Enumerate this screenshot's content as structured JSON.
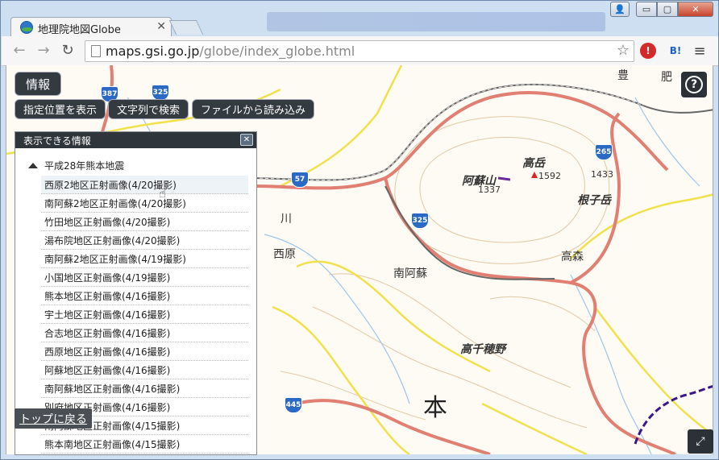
{
  "browser": {
    "tab_title": "地理院地図Globe",
    "tab_close": "✕",
    "url_host": "maps.gsi.go.jp",
    "url_path": "/globe/index_globe.html",
    "window_buttons": {
      "user": "👤",
      "minimize": "▭",
      "maximize": "▢",
      "close": "✕"
    },
    "ext_1": "!",
    "ext_2": "B!",
    "menu": "≡"
  },
  "toolbar": {
    "info_label": "情報",
    "show_location": "指定位置を表示",
    "search_text": "文字列で検索",
    "load_file": "ファイルから読み込み",
    "help": "?"
  },
  "panel": {
    "title": "表示できる情報",
    "close": "✕",
    "group": "平成28年熊本地震",
    "items": [
      "西原2地区正射画像(4/20撮影)",
      "南阿蘇2地区正射画像(4/20撮影)",
      "竹田地区正射画像(4/20撮影)",
      "湯布院地区正射画像(4/20撮影)",
      "南阿蘇2地区正射画像(4/19撮影)",
      "小国地区正射画像(4/19撮影)",
      "熊本地区正射画像(4/16撮影)",
      "宇土地区正射画像(4/16撮影)",
      "合志地区正射画像(4/16撮影)",
      "西原地区正射画像(4/16撮影)",
      "阿蘇地区正射画像(4/16撮影)",
      "南阿蘇地区正射画像(4/16撮影)",
      "別府地区正射画像(4/16撮影)",
      "南阿蘇地区正射画像(4/15撮影)",
      "熊本南地区正射画像(4/15撮影)"
    ]
  },
  "top_link": "トップに戻る",
  "map": {
    "labels": {
      "aso": "阿蘇山",
      "takadake": "高岳",
      "nekodake": "根子岳",
      "nishihara": "西原",
      "minamiaso": "南阿蘇",
      "takamori": "高森",
      "takachiho": "高千穂野",
      "hon": "本",
      "kawa": "川",
      "bu": "豊",
      "hi": "肥"
    },
    "elevations": {
      "e1592": "1592",
      "e1337": "1337",
      "e1433": "1433"
    },
    "routes": {
      "r387": "387",
      "r325a": "325",
      "r57": "57",
      "r325b": "325",
      "r265": "265",
      "r445": "445"
    }
  }
}
